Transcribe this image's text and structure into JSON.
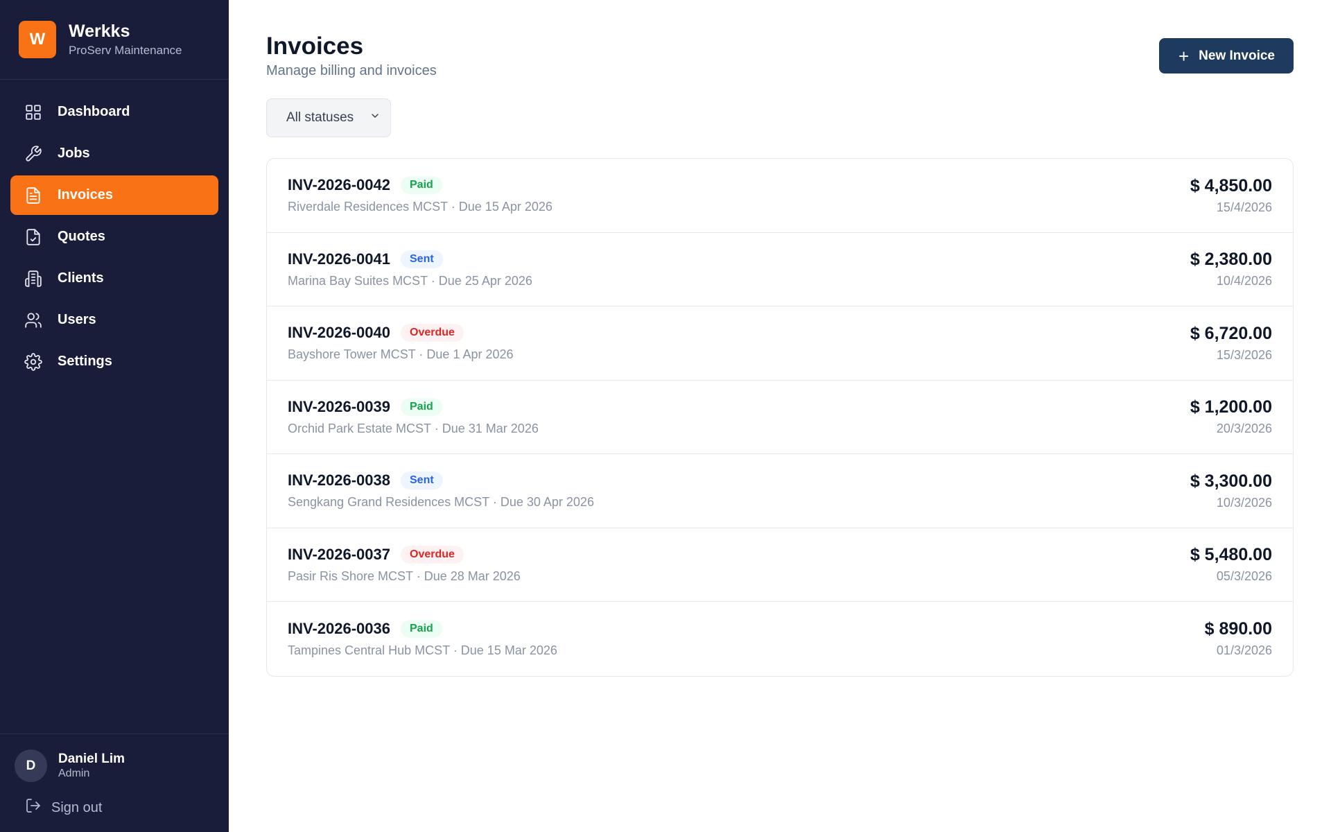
{
  "brand": {
    "logo_letter": "W",
    "name": "Werkks",
    "subtitle": "ProServ Maintenance",
    "accent": "#f97316"
  },
  "sidebar": {
    "items": [
      {
        "label": "Dashboard",
        "icon": "grid-icon",
        "active": false
      },
      {
        "label": "Jobs",
        "icon": "wrench-icon",
        "active": false
      },
      {
        "label": "Invoices",
        "icon": "file-text-icon",
        "active": true
      },
      {
        "label": "Quotes",
        "icon": "file-check-icon",
        "active": false
      },
      {
        "label": "Clients",
        "icon": "building-icon",
        "active": false
      },
      {
        "label": "Users",
        "icon": "users-icon",
        "active": false
      },
      {
        "label": "Settings",
        "icon": "gear-icon",
        "active": false
      }
    ],
    "user": {
      "initial": "D",
      "name": "Daniel Lim",
      "role": "Admin"
    },
    "signout_label": "Sign out"
  },
  "header": {
    "title": "Invoices",
    "subtitle": "Manage billing and invoices",
    "new_button_label": "New Invoice"
  },
  "filter": {
    "selected": "All statuses"
  },
  "invoices": [
    {
      "number": "INV-2026-0042",
      "status": "Paid",
      "status_key": "paid",
      "client": "Riverdale Residences MCST",
      "due": "Due 15 Apr 2026",
      "amount": "$ 4,850.00",
      "date": "15/4/2026"
    },
    {
      "number": "INV-2026-0041",
      "status": "Sent",
      "status_key": "sent",
      "client": "Marina Bay Suites MCST",
      "due": "Due 25 Apr 2026",
      "amount": "$ 2,380.00",
      "date": "10/4/2026"
    },
    {
      "number": "INV-2026-0040",
      "status": "Overdue",
      "status_key": "overdue",
      "client": "Bayshore Tower MCST",
      "due": "Due 1 Apr 2026",
      "amount": "$ 6,720.00",
      "date": "15/3/2026"
    },
    {
      "number": "INV-2026-0039",
      "status": "Paid",
      "status_key": "paid",
      "client": "Orchid Park Estate MCST",
      "due": "Due 31 Mar 2026",
      "amount": "$ 1,200.00",
      "date": "20/3/2026"
    },
    {
      "number": "INV-2026-0038",
      "status": "Sent",
      "status_key": "sent",
      "client": "Sengkang Grand Residences MCST",
      "due": "Due 30 Apr 2026",
      "amount": "$ 3,300.00",
      "date": "10/3/2026"
    },
    {
      "number": "INV-2026-0037",
      "status": "Overdue",
      "status_key": "overdue",
      "client": "Pasir Ris Shore MCST",
      "due": "Due 28 Mar 2026",
      "amount": "$ 5,480.00",
      "date": "05/3/2026"
    },
    {
      "number": "INV-2026-0036",
      "status": "Paid",
      "status_key": "paid",
      "client": "Tampines Central Hub MCST",
      "due": "Due 15 Mar 2026",
      "amount": "$ 890.00",
      "date": "01/3/2026"
    }
  ]
}
